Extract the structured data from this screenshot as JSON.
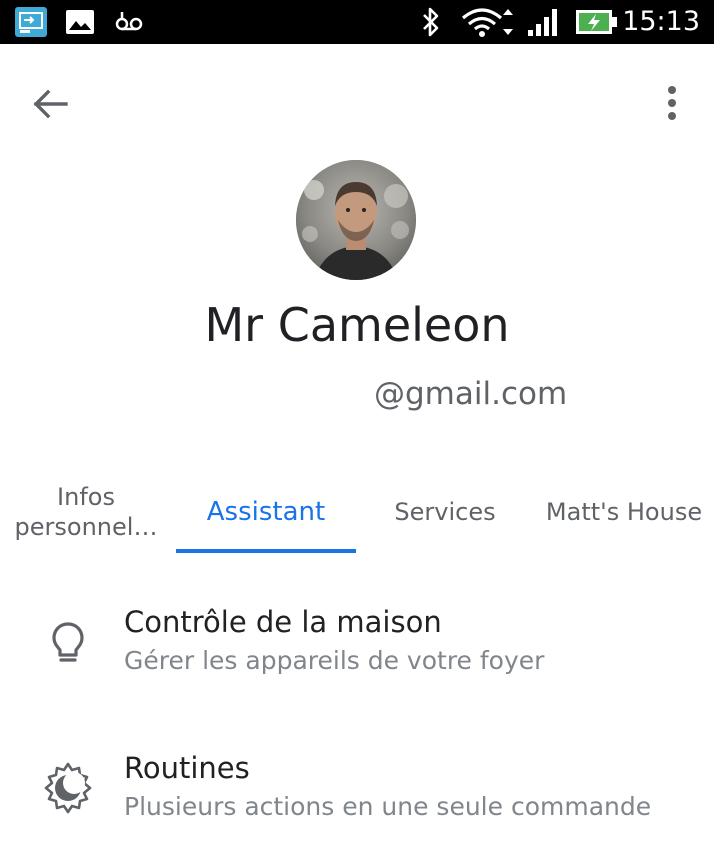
{
  "status_bar": {
    "time": "15:13",
    "icons": [
      "screen-cast-icon",
      "image-icon",
      "voicemail-icon",
      "bluetooth-icon",
      "wifi-icon",
      "signal-icon",
      "battery-charging-icon"
    ]
  },
  "app_bar": {
    "back_icon": "arrow-back-icon",
    "menu_icon": "more-vert-icon"
  },
  "profile": {
    "name": "Mr Cameleon",
    "email": "@gmail.com"
  },
  "tabs": [
    {
      "label": "Infos personnel…",
      "active": false
    },
    {
      "label": "Assistant",
      "active": true
    },
    {
      "label": "Services",
      "active": false
    },
    {
      "label": "Matt's House",
      "active": false
    }
  ],
  "list": [
    {
      "icon": "lightbulb-icon",
      "title": "Contrôle de la maison",
      "subtitle": "Gérer les appareils de votre foyer"
    },
    {
      "icon": "routines-sun-moon-icon",
      "title": "Routines",
      "subtitle": "Plusieurs actions en une seule commande"
    }
  ],
  "colors": {
    "accent": "#1a73e8",
    "primary_text": "#202124",
    "secondary_text": "#5f6368",
    "battery": "#4caf50",
    "status_bar_bg": "#000000"
  }
}
